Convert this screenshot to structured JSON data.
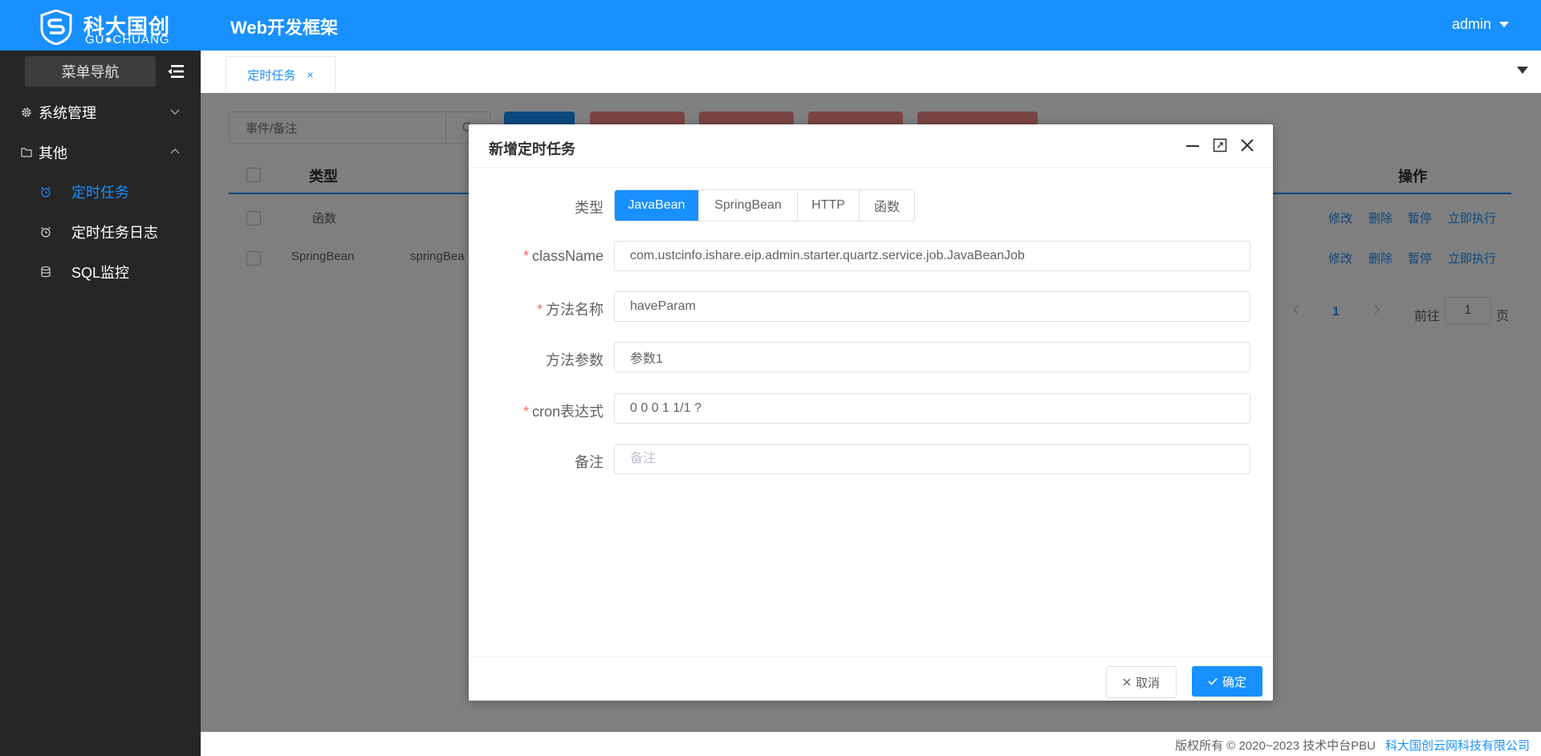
{
  "header": {
    "logo_cn": "科大国创",
    "logo_en": "GU●CHUANG",
    "app_title": "Web开发框架",
    "user": "admin"
  },
  "sidebar": {
    "menu_nav_label": "菜单导航",
    "groups": [
      {
        "label": "系统管理",
        "icon": "gear-icon",
        "expanded": false
      },
      {
        "label": "其他",
        "icon": "folder-icon",
        "expanded": true
      }
    ],
    "sub_items": [
      {
        "label": "定时任务",
        "icon": "alarm-clock-icon",
        "active": true
      },
      {
        "label": "定时任务日志",
        "icon": "alarm-clock-icon",
        "active": false
      },
      {
        "label": "SQL监控",
        "icon": "database-icon",
        "active": false
      }
    ]
  },
  "tabs": [
    {
      "label": "定时任务",
      "close": "×"
    }
  ],
  "content": {
    "search_placeholder": "事件/备注",
    "table": {
      "headers": {
        "type": "类型",
        "actions": "操作"
      },
      "rows": [
        {
          "type": "函数",
          "name": "",
          "actions": [
            "修改",
            "删除",
            "暂停",
            "立即执行"
          ]
        },
        {
          "type": "SpringBean",
          "name": "springBea",
          "actions": [
            "修改",
            "删除",
            "暂停",
            "立即执行"
          ]
        }
      ]
    },
    "pagination": {
      "current": "1",
      "goto_label": "前往",
      "goto_value": "1",
      "page_unit": "页"
    }
  },
  "dialog": {
    "title": "新增定时任务",
    "type_label": "类型",
    "type_options": [
      "JavaBean",
      "SpringBean",
      "HTTP",
      "函数"
    ],
    "type_selected": "JavaBean",
    "fields": [
      {
        "label": "className",
        "required": true,
        "value": "com.ustcinfo.ishare.eip.admin.starter.quartz.service.job.JavaBeanJob",
        "placeholder": ""
      },
      {
        "label": "方法名称",
        "required": true,
        "value": "haveParam",
        "placeholder": ""
      },
      {
        "label": "方法参数",
        "required": false,
        "value": "参数1",
        "placeholder": ""
      },
      {
        "label": "cron表达式",
        "required": true,
        "value": "0 0 0 1 1/1 ?",
        "placeholder": ""
      },
      {
        "label": "备注",
        "required": false,
        "value": "",
        "placeholder": "备注"
      }
    ],
    "required_mark": "*",
    "cancel_label": "取消",
    "ok_label": "确定"
  },
  "footer": {
    "copyright": "版权所有 © 2020~2023 技术中台PBU",
    "company": "科大国创云网科技有限公司"
  },
  "colors": {
    "primary": "#1890ff",
    "sidebar_bg": "#262626",
    "danger": "#f78989",
    "required": "#f56c6c"
  }
}
